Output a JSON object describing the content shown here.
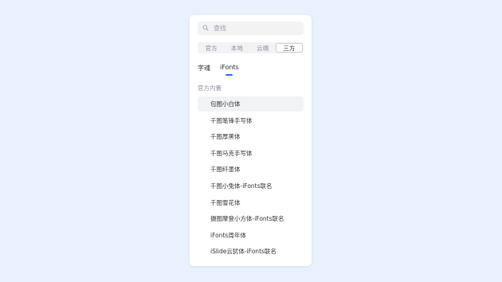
{
  "search": {
    "placeholder": "查找",
    "value": ""
  },
  "source_tabs": [
    "官方",
    "本地",
    "云端",
    "三方"
  ],
  "active_source_tab": 3,
  "font_tabs": [
    "字魂",
    "iFonts"
  ],
  "active_font_tab": 1,
  "section_title": "官方内置",
  "fonts": [
    "包图小白体",
    "千图笔锋手写体",
    "千图厚黑体",
    "千图马克手写体",
    "千图纤墨体",
    "千图小兔体-iFonts联名",
    "千图雪花体",
    "摄图摩登小方体-iFonts联名",
    "iFonts周年体",
    "iSlide云犹体-iFonts联名"
  ],
  "selected_font": 0,
  "colors": {
    "accent": "#2f6bdf",
    "background": "#e8f1fd"
  }
}
